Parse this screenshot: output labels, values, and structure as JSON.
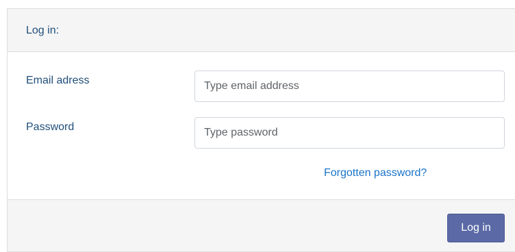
{
  "header": {
    "title": "Log in:"
  },
  "form": {
    "email": {
      "label": "Email adress",
      "value": "",
      "placeholder": "Type email address"
    },
    "password": {
      "label": "Password",
      "value": "",
      "placeholder": "Type password"
    },
    "forgot_link": "Forgotten password?"
  },
  "footer": {
    "submit_label": "Log in"
  },
  "colors": {
    "label_text": "#1f4e79",
    "link": "#1a73c8",
    "button_bg": "#5b6aa6",
    "panel_bg": "#f5f5f5",
    "border": "#dddddd"
  }
}
